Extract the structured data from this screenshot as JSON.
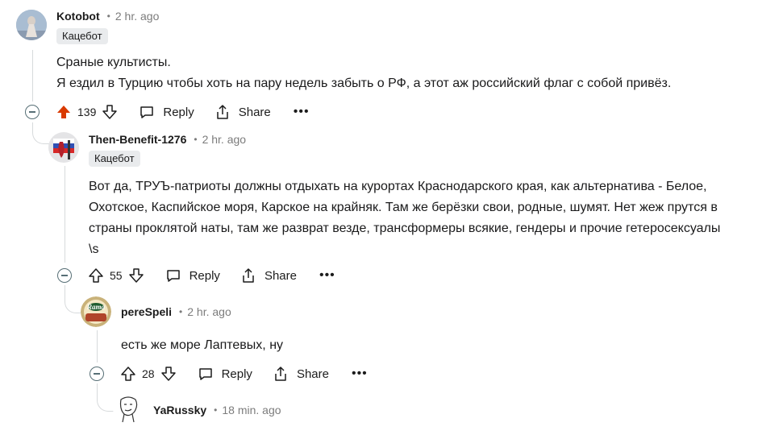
{
  "comments": [
    {
      "author": "Kotobot",
      "time": "2 hr. ago",
      "flair": "Кацебот",
      "body": [
        "Сраные культисты.",
        "Я ездил в Турцию чтобы хоть на пару недель забыть о РФ, а этот аж российский флаг с собой привёз."
      ],
      "votes": "139",
      "reply_label": "Reply",
      "share_label": "Share",
      "more_label": "•••"
    },
    {
      "author": "Then-Benefit-1276",
      "time": "2 hr. ago",
      "flair": "Кацебот",
      "body": [
        "Вот да, ТРУЪ-патриоты должны отдыхать на курортах Краснодарского края, как альтернатива - Белое,",
        "Охотское, Каспийское моря, Карское на крайняк. Там же берёзки свои, родные, шумят. Нет жеж прутся в",
        "страны проклятой наты, там же разврат везде, трансформеры всякие, гендеры и прочие гетеросексуалы",
        "\\s"
      ],
      "votes": "55",
      "reply_label": "Reply",
      "share_label": "Share",
      "more_label": "•••"
    },
    {
      "author": "pereSpeli",
      "time": "2 hr. ago",
      "body": [
        "есть же море Лаптевых, ну"
      ],
      "avatar_text": "Rama",
      "votes": "28",
      "reply_label": "Reply",
      "share_label": "Share",
      "more_label": "•••"
    },
    {
      "author": "YaRussky",
      "time": "18 min. ago"
    }
  ],
  "colors": {
    "upvote_active": "#d93a00",
    "thread_line": "#d7dadc",
    "meta_gray": "#7c7c7c"
  }
}
